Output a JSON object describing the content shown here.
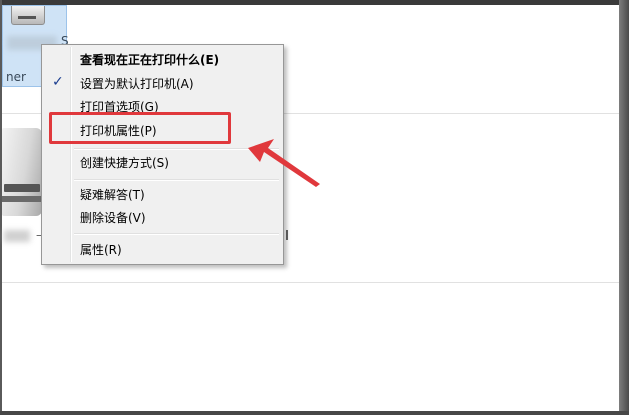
{
  "device_tile": {
    "label_right": "S",
    "label_bottom": "ner"
  },
  "large_printer": {
    "label_fragment": "–"
  },
  "context_menu": {
    "items": [
      {
        "label": "查看现在正在打印什么(E)",
        "bold": true,
        "checked": false
      },
      {
        "label": "设置为默认打印机(A)",
        "bold": false,
        "checked": true
      },
      {
        "label": "打印首选项(G)",
        "bold": false,
        "checked": false
      },
      {
        "label": "打印机属性(P)",
        "bold": false,
        "checked": false
      },
      {
        "label": "创建快捷方式(S)",
        "bold": false,
        "checked": false
      },
      {
        "label": "疑难解答(T)",
        "bold": false,
        "checked": false
      },
      {
        "label": "删除设备(V)",
        "bold": false,
        "checked": false
      },
      {
        "label": "属性(R)",
        "bold": false,
        "checked": false
      }
    ],
    "check_glyph": "✓"
  },
  "annotation": {
    "highlight_color": "#e0383c",
    "highlighted_item": "打印机属性(P)"
  }
}
